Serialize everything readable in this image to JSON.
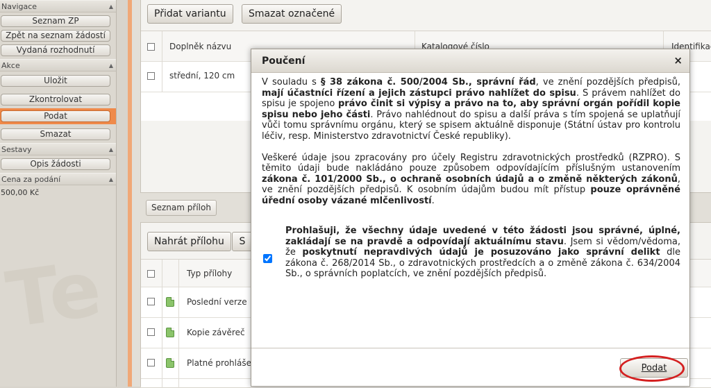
{
  "sidebar": {
    "sections": {
      "navigace": "Navigace",
      "akce": "Akce",
      "sestavy": "Sestavy",
      "cena": "Cena za podání"
    },
    "buttons": {
      "seznam_zp": "Seznam ZP",
      "zpet": "Zpět na seznam žádostí",
      "vydana": "Vydaná rozhodnutí",
      "ulozit": "Uložit",
      "zkontrolovat": "Zkontrolovat",
      "podat": "Podat",
      "smazat": "Smazat",
      "opis": "Opis žádosti"
    },
    "cena_value": "500,00 Kč"
  },
  "variants": {
    "add_button": "Přidat variantu",
    "delete_button": "Smazat označené",
    "columns": [
      "Doplněk názvu",
      "Katalogové číslo",
      "Identifikač"
    ],
    "rows": [
      [
        "střední, 120 cm"
      ]
    ]
  },
  "attachments": {
    "tab_label": "Seznam příloh",
    "upload_button": "Nahrát přílohu",
    "second_button_fragment": "S",
    "column_type": "Typ přílohy",
    "rows": [
      "Poslední verze",
      "Kopie závěreč",
      "Platné prohláše"
    ]
  },
  "modal": {
    "title": "Poučení",
    "close": "×",
    "p1": {
      "a": "V souladu s ",
      "b1": "§ 38 zákona č. 500/2004 Sb., správní řád",
      "c": ", ve znění pozdějších předpisů, ",
      "b2": "mají účastníci řízení a jejich zástupci právo nahlížet do spisu",
      "d": ". S právem nahlížet do spisu je spojeno ",
      "b3": "právo činit si výpisy a právo na to, aby správní orgán pořídil kopie spisu nebo jeho části",
      "e": ". Právo nahlédnout do spisu a další práva s tím spojená se uplatňují vůči tomu správnímu orgánu, který se spisem aktuálně disponuje (Státní ústav pro kontrolu léčiv, resp. Ministerstvo zdravotnictví České republiky)."
    },
    "p2": {
      "a": "Veškeré údaje jsou zpracovány pro účely Registru zdravotnických prostředků (RZPRO). S těmito údaji bude nakládáno pouze způsobem odpovídajícím příslušným ustanovením ",
      "b1": "zákona č. 101/2000 Sb., o ochraně osobních údajů a o změně některých zákonů",
      "c": ", ve znění pozdějších předpisů. K osobním údajům budou mít přístup ",
      "b2": "pouze oprávněné úřední osoby vázané mlčenlivostí",
      "d": "."
    },
    "declaration": {
      "b1": "Prohlašuji, že všechny údaje uvedené v této žádosti jsou správné, úplné, zakládají se na pravdě a odpovídají aktuálnímu stavu",
      "a": ". Jsem si vědom/vědoma, že ",
      "b2": "poskytnutí nepravdivých údajů je posuzováno jako správní delikt",
      "c": " dle zákona č. 268/2014 Sb., o zdravotnických prostředcích a o změně zákona č. 634/2004 Sb., o správních poplatcích, ve znění pozdějších předpisů.",
      "checked": true
    },
    "submit_label": "Podat"
  },
  "colors": {
    "accent_orange": "#ef8a4a",
    "highlight_red": "#d42020"
  }
}
